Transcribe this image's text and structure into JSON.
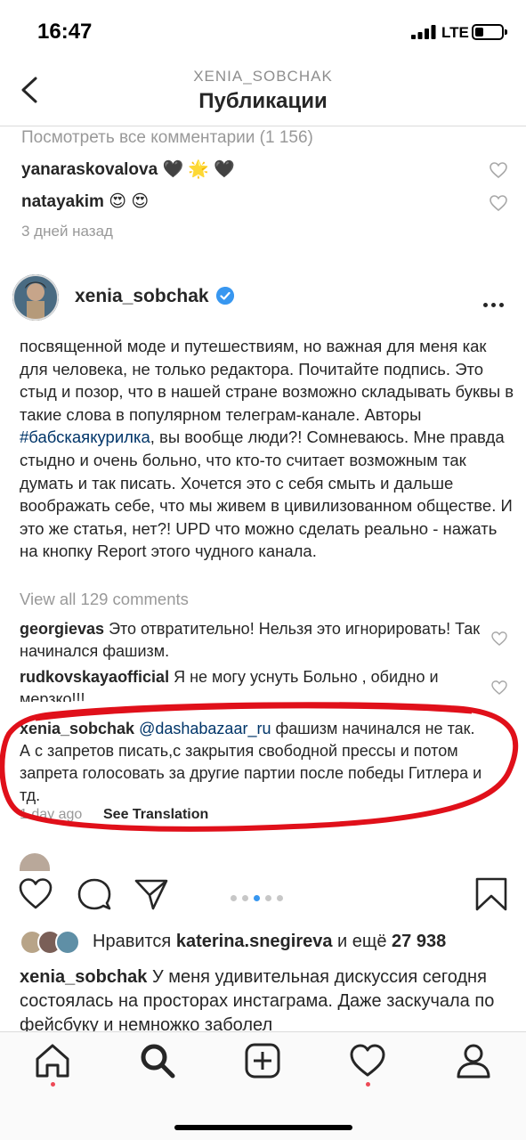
{
  "status_bar": {
    "time": "16:47",
    "network": "LTE"
  },
  "header": {
    "username": "XENIA_SOBCHAK",
    "title": "Публикации"
  },
  "previous_post": {
    "view_all_comments": "Посмотреть все комментарии (1 156)",
    "comments": [
      {
        "user": "yanaraskovalova",
        "text": "🖤 🌟 🖤"
      },
      {
        "user": "natayakim",
        "text": "😍 😍"
      }
    ],
    "time": "3 дней назад"
  },
  "post": {
    "username": "xenia_sobchak",
    "verified": true,
    "screenshot": {
      "paragraph_parts": [
        "посвященной моде и путешествиям, но важная для меня как для человека, не только редактора. Почитайте подпись. Это стыд и позор, что в нашей стране возможно складывать буквы в такие слова в популярном телеграм-канале. Авторы ",
        "#бабскаякурилка",
        ", вы вообще люди?! Сомневаюсь. Мне правда стыдно и очень больно, что кто-то считает возможным так думать и так писать. Хочется это с себя смыть и дальше воображать себе, что мы живем в цивилизованном обществе. И это же статья, нет?! UPD что можно сделать реально - нажать на кнопку Report этого чудного канала."
      ],
      "view_all": "View all 129 comments",
      "comments": [
        {
          "user": "georgievas",
          "text": "Это отвратительно! Нельзя это игнорировать! Так начинался фашизм."
        },
        {
          "user": "rudkovskayaofficial",
          "text": "Я не могу уснуть Больно , обидно и мерзко!!!"
        },
        {
          "user": "xenia_sobchak",
          "mention": "@dashabazaar_ru",
          "text": "фашизм начинался не так. А с запретов писать,с закрытия свободной прессы и потом запрета голосовать за другие партии после победы Гитлера и тд."
        }
      ],
      "time": "1 day ago",
      "see_translation": "See Translation",
      "highlight_color": "#e0101a"
    },
    "carousel": {
      "count": 5,
      "active": 2
    },
    "likes": {
      "prefix": "Нравится",
      "user": "katerina.snegireva",
      "and": "и ещё",
      "count": "27 938"
    },
    "caption": {
      "user": "xenia_sobchak",
      "text": "У меня удивительная дискуссия сегодня состоялась на просторах инстаграма. Даже заскучала по фейсбуку и немножко заболел"
    }
  },
  "icons": [
    "back-icon",
    "verified-icon",
    "more-icon",
    "like-icon",
    "comment-icon",
    "share-icon",
    "bookmark-icon",
    "home-icon",
    "search-icon",
    "new-post-icon",
    "activity-icon",
    "profile-icon"
  ],
  "colors": {
    "accent": "#3897f0",
    "notification": "#ed4956",
    "link": "#003569"
  }
}
